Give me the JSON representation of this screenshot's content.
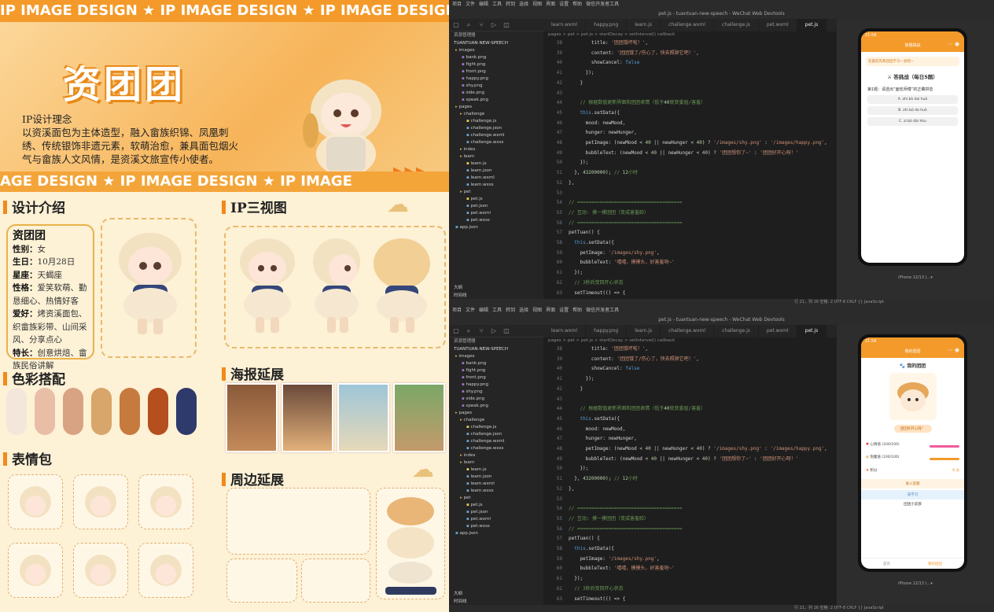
{
  "poster": {
    "band_text": "IP IMAGE DESIGN ★ IP IMAGE DESIGN ★ IP IMAGE DESIGN ★ IP IM",
    "band_text_2": "AGE DESIGN ★ IP IMAGE DESIGN ★ IP IMAGE",
    "title": "资团团",
    "concept": "IP设计理念\n以资溪面包为主体造型，融入畲族织锦、凤凰刺绣、传统银饰非遗元素，软萌治愈，兼具面包烟火气与畲族人文风情，是资溪文旅宣传小使者。",
    "sections": {
      "design_intro": "设计介绍",
      "three_views": "IP三视图",
      "colors": "色彩搭配",
      "poster_ext": "海报延展",
      "emoji": "表情包",
      "merch": "周边延展"
    },
    "bio": {
      "name": "资团团",
      "gender_label": "性别：",
      "gender": "女",
      "birthday_label": "生日：",
      "birthday": "10月28日",
      "sign_label": "星座：",
      "sign": "天蝎座",
      "personality_label": "性格：",
      "personality": "爱笑软萌、勤恳细心、热情好客",
      "hobby_label": "爱好：",
      "hobby": "烤资溪面包、织畲族彩带、山间采风、分享点心",
      "skill_label": "特长：",
      "skill": "创意烘焙、畲族民俗讲解"
    },
    "palette": [
      "#f3e6da",
      "#e8bfa6",
      "#d8a382",
      "#d8a56a",
      "#c77a3e",
      "#b5501e",
      "#2d3a6b"
    ]
  },
  "ide": {
    "menu": [
      "项目",
      "文件",
      "编辑",
      "工具",
      "转到",
      "选择",
      "视图",
      "界面",
      "设置",
      "帮助",
      "微信开发者工具"
    ],
    "window_title": "pet.js - tuantuan-new-speech - WeChat Web Devtools",
    "explorer_title": "资源管理器",
    "project": "TUANTUAN-NEW-SPEECH",
    "tree": [
      "images",
      "bank.png",
      "fight.png",
      "front.png",
      "happy.png",
      "shy.png",
      "side.png",
      "speak.png",
      "pages",
      "challenge",
      "challenge.js",
      "challenge.json",
      "challenge.wxml",
      "challenge.wxss",
      "index",
      "learn",
      "learn.js",
      "learn.json",
      "learn.wxml",
      "learn.wxss",
      "pet",
      "pet.js",
      "pet.json",
      "pet.wxml",
      "pet.wxss",
      "app.json"
    ],
    "tabs": [
      "learn.wxml",
      "happy.png",
      "learn.js",
      "challenge.wxml",
      "challenge.js",
      "pet.wxml",
      "pet.js"
    ],
    "crumbs": "pages > pet > pet.js > startDecay > setInterval() callback",
    "outline": "大纲",
    "timeline": "时间线",
    "status_right": "行 21，列 16  空格: 2  UTF-8  CRLF  {} JavaScript",
    "code": [
      {
        "n": "38",
        "t": "        title: '团团饿坏啦！',"
      },
      {
        "n": "39",
        "t": "        content: '团团饿了/伤心了，快去照顾它吧！',"
      },
      {
        "n": "40",
        "t": "        showCancel: false"
      },
      {
        "n": "41",
        "t": "      });"
      },
      {
        "n": "42",
        "t": "    }"
      },
      {
        "n": "43",
        "t": ""
      },
      {
        "n": "44",
        "t": "    // 根据数值更新界面和团团表情（低于40就变委屈/害羞）"
      },
      {
        "n": "45",
        "t": "    this.setData({"
      },
      {
        "n": "46",
        "t": "      mood: newMood,"
      },
      {
        "n": "47",
        "t": "      hunger: newHunger,"
      },
      {
        "n": "48",
        "t": "      petImage: (newMood < 40 || newHunger < 40) ? '/images/shy.png' : '/images/happy.png',"
      },
      {
        "n": "49",
        "t": "      bubbleText: (newMood < 40 || newHunger < 40) ? '团团想你了~' : '团团好开心呀！'"
      },
      {
        "n": "50",
        "t": "    });"
      },
      {
        "n": "51",
        "t": "  }, 43200000); // 12小时"
      },
      {
        "n": "52",
        "t": "},"
      },
      {
        "n": "53",
        "t": ""
      },
      {
        "n": "54",
        "t": "// ====================================="
      },
      {
        "n": "55",
        "t": "// 互动: 摸一摸团团（变成害羞脸）"
      },
      {
        "n": "56",
        "t": "// ====================================="
      },
      {
        "n": "57",
        "t": "petTuan() {"
      },
      {
        "n": "58",
        "t": "  this.setData({"
      },
      {
        "n": "59",
        "t": "    petImage: '/images/shy.png',"
      },
      {
        "n": "60",
        "t": "    bubbleText: '嘻嘻，摸摸头，好害羞呀~'"
      },
      {
        "n": "61",
        "t": "  });"
      },
      {
        "n": "62",
        "t": "  // 3秒后变回开心状态"
      },
      {
        "n": "63",
        "t": "  setTimeout(() => {"
      }
    ],
    "sim_top": {
      "time": "21:58",
      "nav_title": "答题挑战",
      "banner": "答题前先和团团学习一会吧~",
      "challenge_title": "⚔ 答挑战（每日5题）",
      "question": "第1题：请选出“面包师傅”的正确拼音",
      "options": [
        "A. zhi bò dai huò",
        "B. zhi bò da huò",
        "C. zi bò dài hòu"
      ],
      "device": "iPhone 12/13 (...▾"
    },
    "sim_bot": {
      "time": "21:58",
      "nav_title": "我的团团",
      "heading": "🐾 我的团团",
      "bubble": "团团好开心呀！",
      "mood_label": "心情值 (100/100)",
      "hunger_label": "饱腹值 (100/100)",
      "points_label": "积分",
      "points": "6 分",
      "btn1": "进入答题",
      "btn2": "去学习",
      "shop": "团团小卖部",
      "tab1": "首页",
      "tab2": "我的团团",
      "device": "iPhone 12/13 (...▾"
    }
  }
}
